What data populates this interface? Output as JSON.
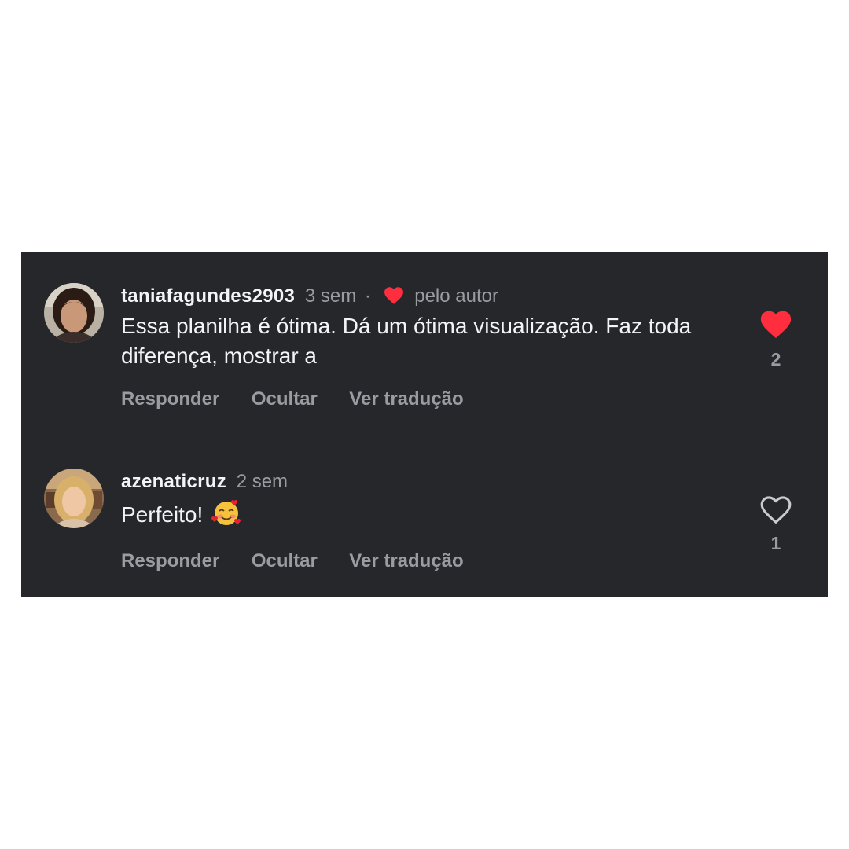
{
  "comments": [
    {
      "username": "taniafagundes2903",
      "time": "3 sem",
      "separator": "·",
      "author_like_label": "pelo autor",
      "text": "Essa planilha é ótima. Dá um ótima visualização. Faz toda diferença, mostrar a",
      "actions": {
        "reply": "Responder",
        "hide": "Ocultar",
        "translate": "Ver tradução"
      },
      "liked": true,
      "like_count": "2",
      "like_icon": "heart-filled-icon"
    },
    {
      "username": "azenaticruz",
      "time": "2 sem",
      "text": "Perfeito!",
      "emoji": "smiling-face-with-hearts",
      "actions": {
        "reply": "Responder",
        "hide": "Ocultar",
        "translate": "Ver tradução"
      },
      "liked": false,
      "like_count": "1",
      "like_icon": "heart-outline-icon"
    }
  ],
  "colors": {
    "panel_bg": "#25272b",
    "primary_text": "#f3f4f6",
    "secondary_text": "#9a9ca1",
    "like_red": "#ff2e3f"
  }
}
